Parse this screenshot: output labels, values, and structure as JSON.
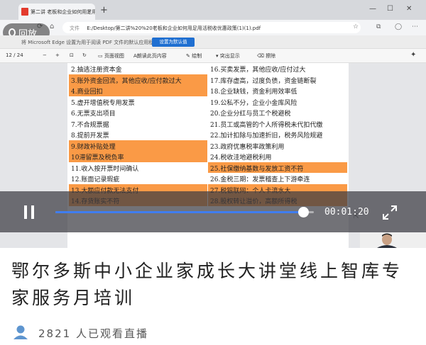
{
  "browser": {
    "tab_title": "第二讲 老板和企业如何用足用",
    "tab_close": "×",
    "new_tab": "+",
    "address_prefix": "文件",
    "address": "E:/Desktop/第二讲%20%20老板和企业如何用足用活税收优惠政策(1)(1).pdf",
    "notification_text": "将 Microsoft Edge 设置为用于阅读 PDF 文件的默认应用程序?",
    "notification_button": "设置为默认值"
  },
  "replay_badge": "回放",
  "pdf_toolbar": {
    "page_current": "12",
    "page_total": "/ 24",
    "tools": [
      "页面视图",
      "朗读此页内容",
      "绘制",
      "突出显示",
      "擦除"
    ]
  },
  "table": {
    "colors": {
      "orange": "#fa9a46",
      "white": "#ffffff"
    },
    "rows": [
      {
        "left": "2.抽逃注册资本金",
        "left_hl": false,
        "right": "16.买卖发票，其他应收/应付过大",
        "right_hl": false
      },
      {
        "left": "3.账外资金回流，其他应收/应付款过大",
        "left_hl": true,
        "right": "17.库存虚高，过度负债，资金链断裂",
        "right_hl": false
      },
      {
        "left": "4.商业回扣",
        "left_hl": true,
        "right": "18.企业缺钱，资金利用效率低",
        "right_hl": false
      },
      {
        "left": "5.虚开增值税专用发票",
        "left_hl": false,
        "right": "19.公私不分，企业小金库风险",
        "right_hl": false
      },
      {
        "left": "6.无票支出项目",
        "left_hl": false,
        "right": "20.企业分红与员工个税避税",
        "right_hl": false
      },
      {
        "left": "7.不合规票据",
        "left_hl": false,
        "right": "21.员工或高管的个人所得税未代扣代缴",
        "right_hl": false
      },
      {
        "left": "8.提前开发票",
        "left_hl": false,
        "right": "22.加计扣除与加速折旧，税务风险规避",
        "right_hl": false
      },
      {
        "left": "9.财政补贴处理",
        "left_hl": true,
        "right": "23.政府优惠税率政策利用",
        "right_hl": false
      },
      {
        "left": "10滞留票及税负率",
        "left_hl": true,
        "right": "24.税收洼地避税利用",
        "right_hl": false
      },
      {
        "left": "11.收入按开票时间确认",
        "left_hl": false,
        "right": "25.社保缴纳基数与发放工资不符",
        "right_hl": true
      },
      {
        "left": "12.账面记录瑕疵",
        "left_hl": false,
        "right": "26.金税三期：发票稽查上下游牵连",
        "right_hl": false
      },
      {
        "left": "13.大额应付款无法支付",
        "left_hl": true,
        "right": "27.税银联网：个人卡流水大",
        "right_hl": true
      },
      {
        "left": "14.存货账实不符",
        "left_hl": true,
        "right": "28.股权转让溢价，高额所得税",
        "right_hl": true
      }
    ]
  },
  "player": {
    "progress": 0.96,
    "time": "00:01:20",
    "accent": "#3f7df0"
  },
  "headline": "鄂尔多斯中小企业家成长大讲堂线上智库专家服务月培训",
  "viewers": "2821 人已观看直播"
}
